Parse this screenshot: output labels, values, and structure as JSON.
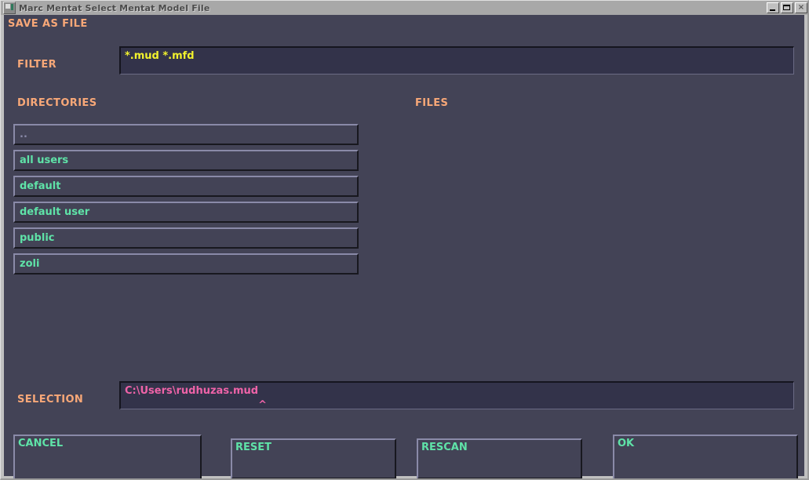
{
  "window": {
    "title": "Marc Mentat Select Mentat Model File",
    "icon": "application-window-icon",
    "controls": {
      "minimize": "minimize-icon",
      "maximize": "maximize-icon",
      "close": "×"
    }
  },
  "dialog": {
    "heading": "SAVE AS FILE",
    "filter": {
      "label": "FILTER",
      "value": "*.mud *.mfd",
      "placeholder": "*.mud *.mfd"
    },
    "directories": {
      "label": "DIRECTORIES",
      "items": [
        {
          "name": ".."
        },
        {
          "name": "all users"
        },
        {
          "name": "default"
        },
        {
          "name": "default user"
        },
        {
          "name": "public"
        },
        {
          "name": "zoli"
        }
      ]
    },
    "files": {
      "label": "FILES",
      "items": []
    },
    "selection": {
      "label": "SELECTION",
      "value": "C:\\Users\\rudhuzas.mud",
      "placeholder": "C:\\Users\\"
    },
    "buttons": {
      "cancel": "CANCEL",
      "reset": "RESET",
      "rescan": "RESCAN",
      "ok": "OK"
    }
  },
  "colors": {
    "dialog_bg": "#434356",
    "field_bg": "#33334a",
    "heading": "#f8a878",
    "filter_text": "#f2f22d",
    "selection_text": "#ef63a8",
    "list_text": "#5fe3a8",
    "bevel_light": "#8a8aa8",
    "bevel_dark": "#18181f",
    "titlebar_bg": "#a8a8a8",
    "frame": "#c0c0c0"
  }
}
